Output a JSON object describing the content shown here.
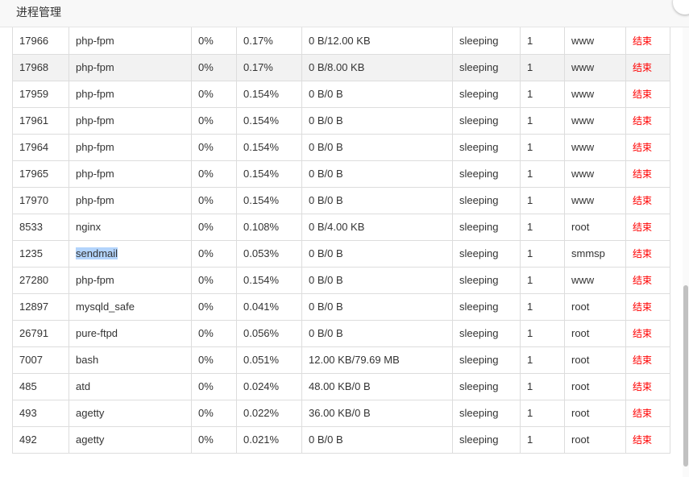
{
  "window": {
    "title": "进程管理"
  },
  "table": {
    "kill_label": "结束",
    "rows": [
      {
        "pid": "17966",
        "name": "php-fpm",
        "cpu": "0%",
        "mem": "0.17%",
        "io": "0 B/12.00 KB",
        "status": "sleeping",
        "threads": "1",
        "user": "www"
      },
      {
        "pid": "17968",
        "name": "php-fpm",
        "cpu": "0%",
        "mem": "0.17%",
        "io": "0 B/8.00 KB",
        "status": "sleeping",
        "threads": "1",
        "user": "www"
      },
      {
        "pid": "17959",
        "name": "php-fpm",
        "cpu": "0%",
        "mem": "0.154%",
        "io": "0 B/0 B",
        "status": "sleeping",
        "threads": "1",
        "user": "www"
      },
      {
        "pid": "17961",
        "name": "php-fpm",
        "cpu": "0%",
        "mem": "0.154%",
        "io": "0 B/0 B",
        "status": "sleeping",
        "threads": "1",
        "user": "www"
      },
      {
        "pid": "17964",
        "name": "php-fpm",
        "cpu": "0%",
        "mem": "0.154%",
        "io": "0 B/0 B",
        "status": "sleeping",
        "threads": "1",
        "user": "www"
      },
      {
        "pid": "17965",
        "name": "php-fpm",
        "cpu": "0%",
        "mem": "0.154%",
        "io": "0 B/0 B",
        "status": "sleeping",
        "threads": "1",
        "user": "www"
      },
      {
        "pid": "17970",
        "name": "php-fpm",
        "cpu": "0%",
        "mem": "0.154%",
        "io": "0 B/0 B",
        "status": "sleeping",
        "threads": "1",
        "user": "www"
      },
      {
        "pid": "8533",
        "name": "nginx",
        "cpu": "0%",
        "mem": "0.108%",
        "io": "0 B/4.00 KB",
        "status": "sleeping",
        "threads": "1",
        "user": "root"
      },
      {
        "pid": "1235",
        "name": "sendmail",
        "cpu": "0%",
        "mem": "0.053%",
        "io": "0 B/0 B",
        "status": "sleeping",
        "threads": "1",
        "user": "smmsp"
      },
      {
        "pid": "27280",
        "name": "php-fpm",
        "cpu": "0%",
        "mem": "0.154%",
        "io": "0 B/0 B",
        "status": "sleeping",
        "threads": "1",
        "user": "www"
      },
      {
        "pid": "12897",
        "name": "mysqld_safe",
        "cpu": "0%",
        "mem": "0.041%",
        "io": "0 B/0 B",
        "status": "sleeping",
        "threads": "1",
        "user": "root"
      },
      {
        "pid": "26791",
        "name": "pure-ftpd",
        "cpu": "0%",
        "mem": "0.056%",
        "io": "0 B/0 B",
        "status": "sleeping",
        "threads": "1",
        "user": "root"
      },
      {
        "pid": "7007",
        "name": "bash",
        "cpu": "0%",
        "mem": "0.051%",
        "io": "12.00 KB/79.69 MB",
        "status": "sleeping",
        "threads": "1",
        "user": "root"
      },
      {
        "pid": "485",
        "name": "atd",
        "cpu": "0%",
        "mem": "0.024%",
        "io": "48.00 KB/0 B",
        "status": "sleeping",
        "threads": "1",
        "user": "root"
      },
      {
        "pid": "493",
        "name": "agetty",
        "cpu": "0%",
        "mem": "0.022%",
        "io": "36.00 KB/0 B",
        "status": "sleeping",
        "threads": "1",
        "user": "root"
      },
      {
        "pid": "492",
        "name": "agetty",
        "cpu": "0%",
        "mem": "0.021%",
        "io": "0 B/0 B",
        "status": "sleeping",
        "threads": "1",
        "user": "root"
      }
    ]
  }
}
